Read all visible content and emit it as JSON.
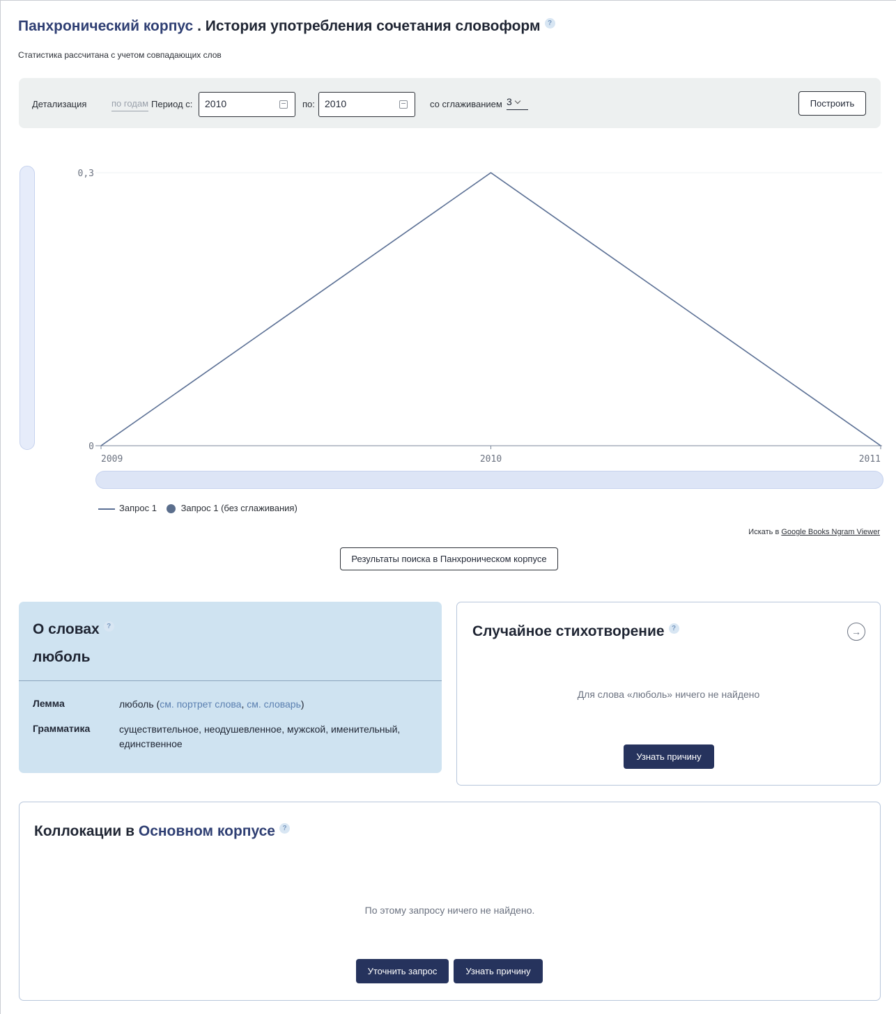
{
  "header": {
    "title_link": "Панхронический корпус",
    "title_rest": " . История употребления сочетания словоформ",
    "help": "?",
    "subtitle": "Статистика рассчитана с учетом совпадающих слов"
  },
  "controls": {
    "detail_label": "Детализация",
    "detail_value": "по годам",
    "period_label": "Период с:",
    "from_value": "2010",
    "to_label": "по:",
    "to_value": "2010",
    "smooth_label": "со сглаживанием",
    "smooth_value": "3",
    "build_button": "Построить"
  },
  "chart_data": {
    "type": "line",
    "x": [
      2009,
      2010,
      2011
    ],
    "y_ticks": [
      "0",
      "0,3"
    ],
    "x_ticks": [
      "2009",
      "2010",
      "2011"
    ],
    "ylim": [
      0,
      0.3
    ],
    "series": [
      {
        "name": "Запрос 1",
        "values": [
          0,
          0.3,
          0
        ],
        "color": "#5a6f94"
      }
    ],
    "legend": [
      {
        "label": "Запрос 1",
        "kind": "line"
      },
      {
        "label": "Запрос 1 (без сглаживания)",
        "kind": "dot"
      }
    ],
    "grid": true
  },
  "ngram": {
    "prefix": "Искать в ",
    "link": "Google Books Ngram Viewer"
  },
  "results_button": "Результаты поиска в Панхроническом корпусе",
  "words_card": {
    "title": "О словах",
    "help": "?",
    "word": "люболь",
    "lemma_label": "Лемма",
    "lemma_value": "люболь (",
    "lemma_link1": "см. портрет слова",
    "lemma_sep": ", ",
    "lemma_link2": "см. словарь",
    "lemma_close": ")",
    "grammar_label": "Грамматика",
    "grammar_value": "существительное, неодушевленное, мужской, именительный, единственное"
  },
  "poem_card": {
    "title": "Случайное стихотворение",
    "help": "?",
    "arrow": "→",
    "message": "Для слова «люболь» ничего не найдено",
    "button": "Узнать причину"
  },
  "colloc_card": {
    "title_prefix": "Коллокации в ",
    "title_link": "Основном корпусе",
    "help": "?",
    "message": "По этому запросу ничего не найдено.",
    "refine_button": "Уточнить запрос",
    "reason_button": "Узнать причину"
  }
}
